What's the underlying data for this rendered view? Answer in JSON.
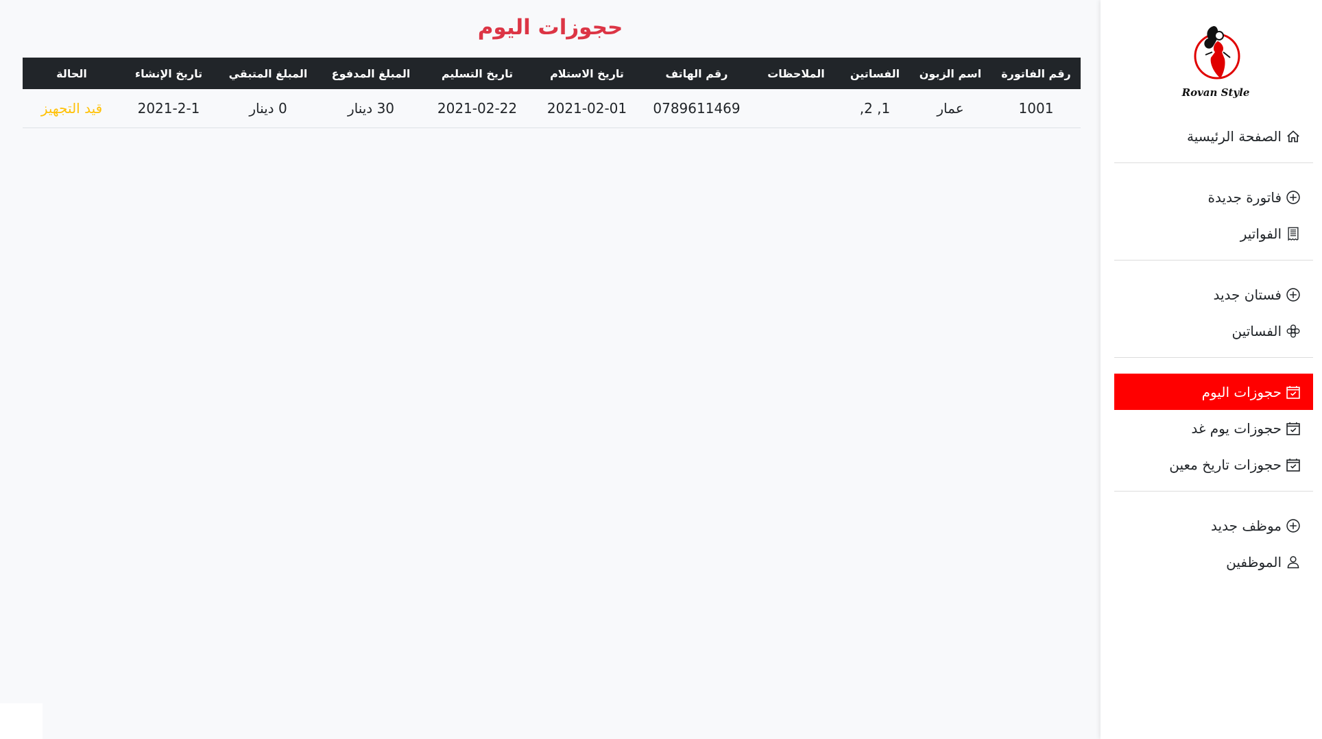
{
  "brand": {
    "logo_text": "Rovan Style"
  },
  "sidebar": {
    "items": [
      {
        "label": "الصفحة الرئيسية",
        "icon": "home-icon"
      },
      {
        "label": "فاتورة جديدة",
        "icon": "plus-circle-icon"
      },
      {
        "label": "الفواتير",
        "icon": "receipt-icon"
      },
      {
        "label": "فستان جديد",
        "icon": "plus-circle-icon"
      },
      {
        "label": "الفساتين",
        "icon": "flower-icon"
      },
      {
        "label": "حجوزات اليوم",
        "icon": "calendar-check-icon",
        "active": true
      },
      {
        "label": "حجوزات يوم غد",
        "icon": "calendar-check-icon"
      },
      {
        "label": "حجوزات تاريخ معين",
        "icon": "calendar-check-icon"
      },
      {
        "label": "موظف جديد",
        "icon": "plus-circle-icon"
      },
      {
        "label": "الموظفين",
        "icon": "person-icon"
      }
    ]
  },
  "main": {
    "title": "حجوزات اليوم",
    "table": {
      "headers": [
        "رقم الفاتورة",
        "اسم الزبون",
        "الفساتين",
        "الملاحظات",
        "رقم الهاتف",
        "تاريخ الاستلام",
        "تاريخ التسليم",
        "المبلغ المدفوع",
        "المبلغ المتبقي",
        "تاريخ الإنشاء",
        "الحالة"
      ],
      "rows": [
        [
          "1001",
          "عمار",
          "1, 2,",
          "",
          "0789611469",
          "2021-02-01",
          "2021-02-22",
          "30 دينار",
          "0 دينار",
          "2021-2-1",
          "قيد التجهيز"
        ]
      ]
    }
  },
  "colors": {
    "active_nav": "#ff0000",
    "title": "#dc3545",
    "table_header": "#212529",
    "status_pending": "#ffc107"
  }
}
